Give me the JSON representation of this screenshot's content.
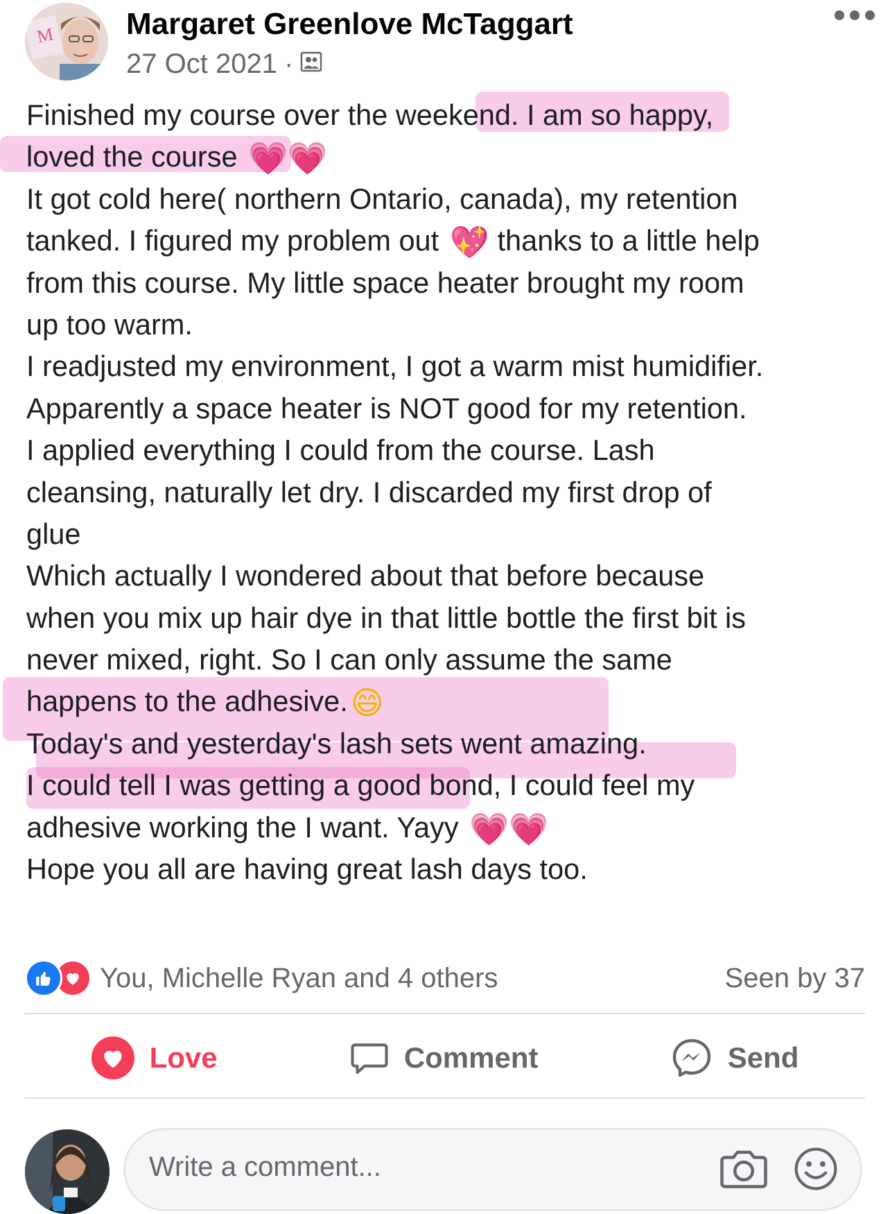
{
  "post": {
    "author": "Margaret Greenlove McTaggart",
    "date": "27 Oct 2021",
    "separator": "·",
    "lines": [
      {
        "text": "Finished my course over the weekend. I am so happy,"
      },
      {
        "text": "loved the course",
        "suffix": "💗💗"
      },
      {
        "text": "It got cold here( northern Ontario, canada), my retention"
      },
      {
        "text": "tanked. I figured my problem out",
        "suffix": "💖",
        "after": "thanks to a little help"
      },
      {
        "text": "from this course. My little space heater brought my room"
      },
      {
        "text": "up too warm."
      },
      {
        "text": "I readjusted my environment, I got a warm mist humidifier."
      },
      {
        "text": "Apparently a space heater is NOT good for my retention."
      },
      {
        "text": "I applied everything I could from the course. Lash"
      },
      {
        "text": "cleansing, naturally let dry. I discarded my first drop of"
      },
      {
        "text": "glue"
      },
      {
        "text": "Which actually I wondered about that before because"
      },
      {
        "text": "when you mix up hair dye in that little bottle the first bit is"
      },
      {
        "text": "never mixed, right. So I can only assume the same"
      },
      {
        "text": "happens to the adhesive.",
        "suffix": "😄"
      },
      {
        "text": "Today's and yesterday's lash sets went amazing."
      },
      {
        "text": "I could tell I was getting a good bond, I could feel my"
      },
      {
        "text": "adhesive working the I want. Yayy",
        "suffix": "💗💗"
      },
      {
        "text": "Hope you all are having great lash days too."
      }
    ]
  },
  "reactions": {
    "text": "You, Michelle Ryan and 4 others",
    "seen": "Seen by 37"
  },
  "actions": {
    "love": "Love",
    "comment": "Comment",
    "send": "Send"
  },
  "comment_input": {
    "placeholder": "Write a comment..."
  },
  "colors": {
    "highlight": "#ec7ac8",
    "love": "#f33e58",
    "like": "#1877f2",
    "secondary_text": "#65676b"
  },
  "icons": [
    "ellipsis-icon",
    "members-icon",
    "like-reaction-icon",
    "love-reaction-icon",
    "love-icon",
    "comment-icon",
    "messenger-icon",
    "camera-icon",
    "emoji-icon"
  ]
}
